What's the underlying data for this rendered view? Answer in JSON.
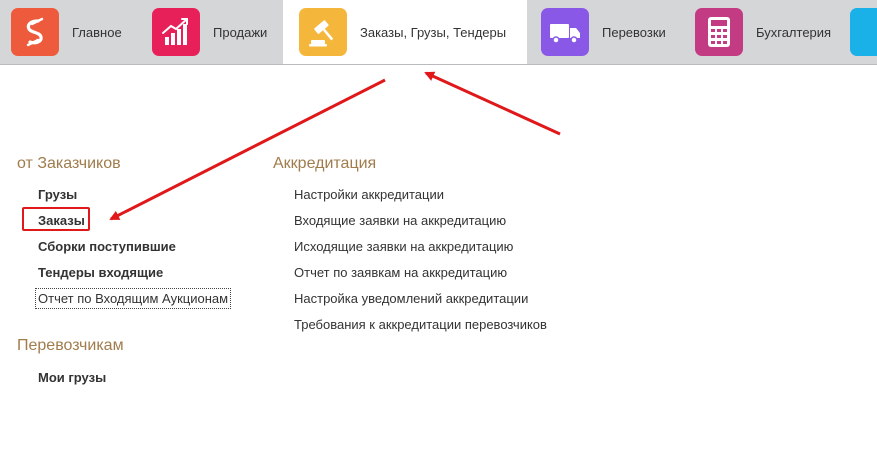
{
  "sections": [
    {
      "label": "Главное",
      "icon": "percent-s-icon",
      "color": "#ee5a3c"
    },
    {
      "label": "Продажи",
      "icon": "chart-growth-icon",
      "color": "#e8205a"
    },
    {
      "label": "Заказы,  Грузы, Тендеры",
      "icon": "gavel-icon",
      "color": "#f4b73c",
      "active": true
    },
    {
      "label": "Перевозки",
      "icon": "truck-icon",
      "color": "#8a58e6"
    },
    {
      "label": "Бухгалтерия",
      "icon": "calculator-icon",
      "color": "#c23b83"
    },
    {
      "label": "",
      "icon": "partial-icon",
      "color": "#1ab0e8"
    }
  ],
  "customers": {
    "title": "от Заказчиков",
    "items": [
      {
        "label": "Грузы"
      },
      {
        "label": "Заказы"
      },
      {
        "label": "Сборки поступившие"
      },
      {
        "label": "Тендеры входящие"
      },
      {
        "label": "Отчет по Входящим Аукционам"
      }
    ]
  },
  "carriers": {
    "title": "Перевозчикам",
    "items": [
      {
        "label": "Мои грузы"
      }
    ]
  },
  "accreditation": {
    "title": "Аккредитация",
    "items": [
      {
        "label": "Настройки аккредитации"
      },
      {
        "label": "Входящие заявки на аккредитацию"
      },
      {
        "label": "Исходящие заявки на аккредитацию"
      },
      {
        "label": "Отчет по заявкам на аккредитацию"
      },
      {
        "label": "Настройка уведомлений аккредитации"
      },
      {
        "label": "Требования к аккредитации перевозчиков"
      }
    ]
  },
  "annotation_color": "#e0181a"
}
